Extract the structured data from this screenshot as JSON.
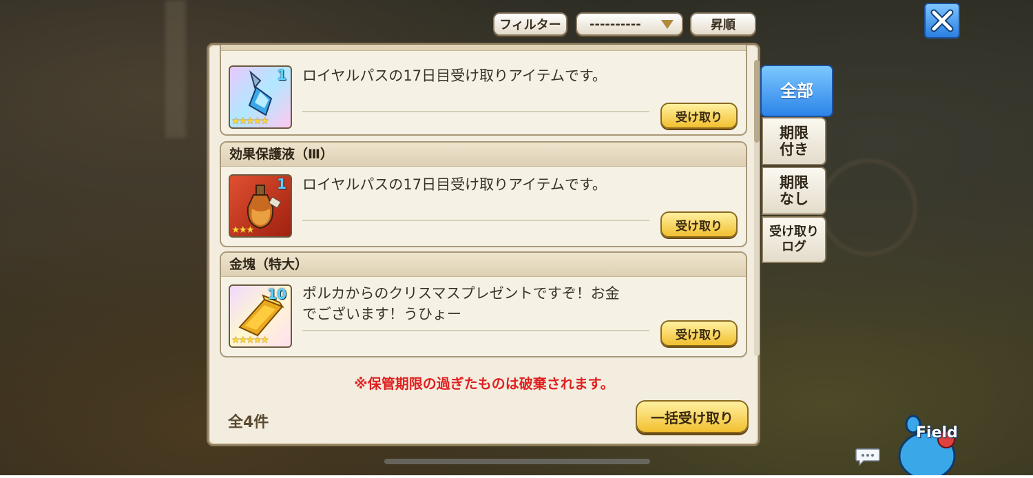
{
  "toolbar": {
    "filter_label": "フィルター",
    "filter_select_value": "----------",
    "sort_label": "昇順"
  },
  "items": [
    {
      "name": "",
      "description_line1": "ロイヤルパスの17日目受け取りアイテムです。",
      "description_line2": "",
      "quantity": "1",
      "stars": "★★★★★",
      "claim_label": "受け取り",
      "icon": "crystal-spear-icon"
    },
    {
      "name": "効果保護液（Ⅲ）",
      "description_line1": "ロイヤルパスの17日目受け取りアイテムです。",
      "description_line2": "",
      "quantity": "1",
      "stars": "★★★",
      "claim_label": "受け取り",
      "icon": "potion-bottle-icon"
    },
    {
      "name": "金塊（特大）",
      "description_line1": "ポルカからのクリスマスプレゼントですぞ！お金",
      "description_line2": "でございます！うひょー",
      "quantity": "10",
      "stars": "★★★★★",
      "claim_label": "受け取り",
      "icon": "gold-bar-icon"
    }
  ],
  "notice": "※保管期限の過ぎたものは破棄されます。",
  "total_count": "全4件",
  "claim_all_label": "一括受け取り",
  "tabs": [
    {
      "label": "全部"
    },
    {
      "line1": "期限",
      "line2": "付き"
    },
    {
      "line1": "期限",
      "line2": "なし"
    },
    {
      "line1": "受け取り",
      "line2": "ログ"
    }
  ],
  "field_label": "Field",
  "colors": {
    "accent_blue": "#2c84e8",
    "claim_gold": "#f2c030",
    "notice_red": "#e02020"
  }
}
